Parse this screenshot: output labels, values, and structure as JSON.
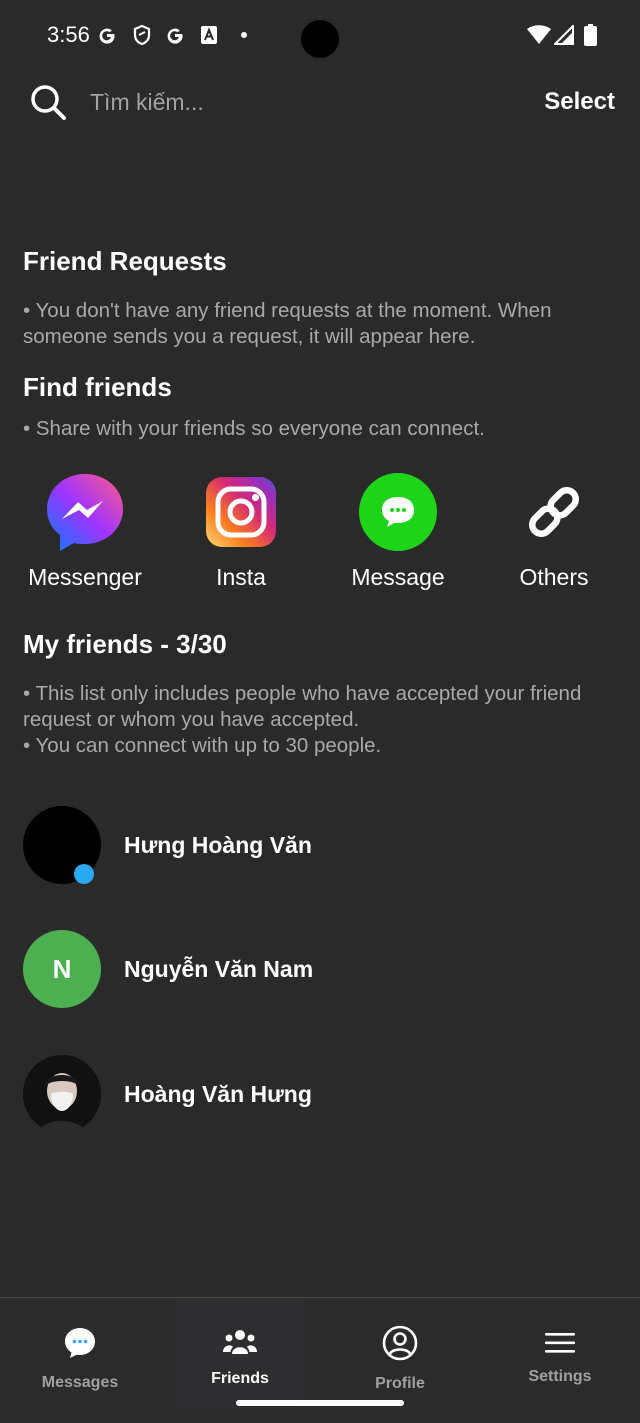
{
  "status_bar": {
    "time": "3:56",
    "icons": [
      "google-icon",
      "shield-icon",
      "google-icon",
      "a-icon",
      "dot-icon",
      "wifi-icon",
      "signal-icon",
      "battery-icon"
    ]
  },
  "search": {
    "placeholder": "Tìm kiếm...",
    "value": "",
    "select_label": "Select"
  },
  "friend_requests": {
    "title": "Friend Requests",
    "text": "• You don't have any friend requests at the moment. When someone sends you a request, it will appear here."
  },
  "find_friends": {
    "title": "Find friends",
    "text": "• Share with your friends so everyone can connect.",
    "share_options": [
      {
        "label": "Messenger",
        "icon": "messenger-icon"
      },
      {
        "label": "Insta",
        "icon": "instagram-icon"
      },
      {
        "label": "Message",
        "icon": "message-icon"
      },
      {
        "label": "Others",
        "icon": "link-icon"
      }
    ]
  },
  "my_friends": {
    "title": "My friends - 3/30",
    "text_1": "• This list only includes people who have accepted your friend request or whom you have accepted.",
    "text_2": "• You can connect with up to 30 people.",
    "friends": [
      {
        "name": "Hưng Hoàng Văn",
        "avatar_type": "photo-black",
        "online": true
      },
      {
        "name": "Nguyễn Văn Nam",
        "avatar_type": "initial",
        "initial": "N",
        "avatar_color": "#4caf50",
        "online": false
      },
      {
        "name": "Hoàng Văn Hưng",
        "avatar_type": "photo",
        "online": false
      }
    ]
  },
  "bottom_nav": {
    "items": [
      {
        "label": "Messages",
        "icon": "chat-bubble-icon",
        "active": false
      },
      {
        "label": "Friends",
        "icon": "friends-icon",
        "active": true
      },
      {
        "label": "Profile",
        "icon": "profile-icon",
        "active": false
      },
      {
        "label": "Settings",
        "icon": "menu-icon",
        "active": false
      }
    ]
  },
  "colors": {
    "background": "#2a2a2b",
    "accent_online": "#2aa8f2",
    "message_green": "#1ed419",
    "avatar_green": "#4caf50"
  }
}
